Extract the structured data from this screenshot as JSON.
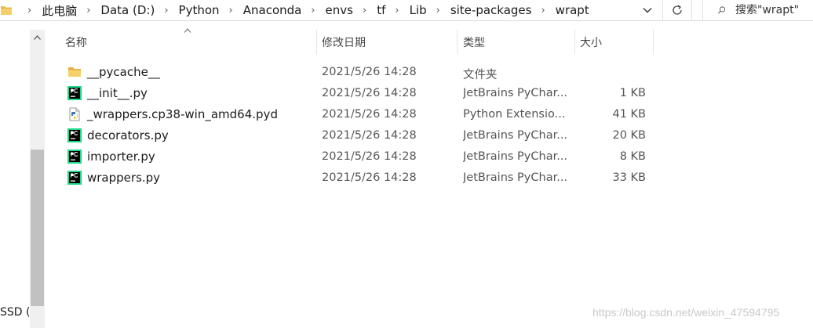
{
  "address": {
    "breadcrumbs": [
      "此电脑",
      "Data (D:)",
      "Python",
      "Anaconda",
      "envs",
      "tf",
      "Lib",
      "site-packages",
      "wrapt"
    ]
  },
  "search": {
    "placeholder": "搜索\"wrapt\""
  },
  "nav": {
    "visible_label": "SSD ("
  },
  "columns": {
    "name": "名称",
    "date": "修改日期",
    "type": "类型",
    "size": "大小"
  },
  "files": [
    {
      "name": "__pycache__",
      "date": "2021/5/26 14:28",
      "type": "文件夹",
      "size": "",
      "icon": "folder-icon"
    },
    {
      "name": "__init__.py",
      "date": "2021/5/26 14:28",
      "type": "JetBrains PyChar...",
      "size": "1 KB",
      "icon": "pycharm-file-icon"
    },
    {
      "name": "_wrappers.cp38-win_amd64.pyd",
      "date": "2021/5/26 14:28",
      "type": "Python Extensio...",
      "size": "41 KB",
      "icon": "python-extension-icon"
    },
    {
      "name": "decorators.py",
      "date": "2021/5/26 14:28",
      "type": "JetBrains PyChar...",
      "size": "20 KB",
      "icon": "pycharm-file-icon"
    },
    {
      "name": "importer.py",
      "date": "2021/5/26 14:28",
      "type": "JetBrains PyChar...",
      "size": "8 KB",
      "icon": "pycharm-file-icon"
    },
    {
      "name": "wrappers.py",
      "date": "2021/5/26 14:28",
      "type": "JetBrains PyChar...",
      "size": "33 KB",
      "icon": "pycharm-file-icon"
    }
  ],
  "watermark": "https://blog.csdn.net/weixin_47594795"
}
